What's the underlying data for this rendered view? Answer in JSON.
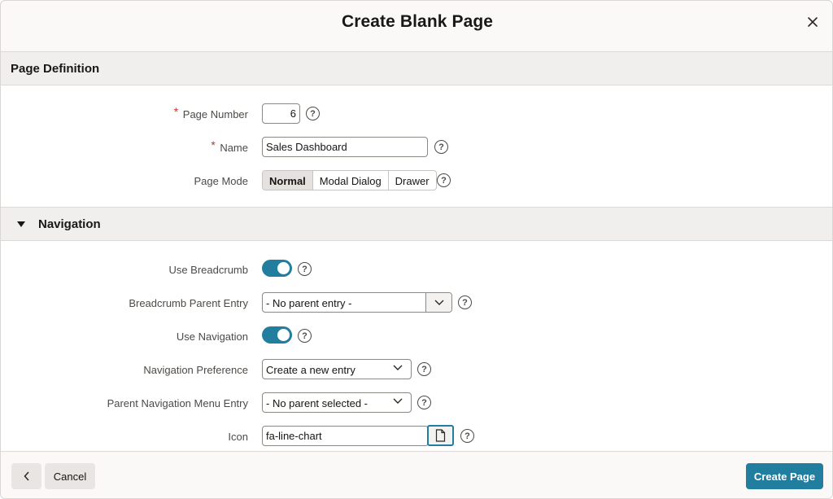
{
  "dialog": {
    "title": "Create Blank Page"
  },
  "page_definition": {
    "section_title": "Page Definition",
    "page_number": {
      "label": "Page Number",
      "value": "6",
      "required": true
    },
    "name": {
      "label": "Name",
      "value": "Sales Dashboard",
      "required": true
    },
    "page_mode": {
      "label": "Page Mode",
      "options": [
        "Normal",
        "Modal Dialog",
        "Drawer"
      ],
      "selected": "Normal"
    }
  },
  "navigation": {
    "section_title": "Navigation",
    "use_breadcrumb": {
      "label": "Use Breadcrumb",
      "on": true
    },
    "breadcrumb_parent": {
      "label": "Breadcrumb Parent Entry",
      "value": "- No parent entry -"
    },
    "use_navigation": {
      "label": "Use Navigation",
      "on": true
    },
    "navigation_preference": {
      "label": "Navigation Preference",
      "value": "Create a new entry"
    },
    "parent_nav_menu": {
      "label": "Parent Navigation Menu Entry",
      "value": "- No parent selected -"
    },
    "icon": {
      "label": "Icon",
      "value": "fa-line-chart"
    }
  },
  "help_glyph": "?",
  "footer": {
    "cancel_label": "Cancel",
    "create_label": "Create Page"
  },
  "colors": {
    "accent": "#227e9e",
    "required": "#c0372b"
  }
}
